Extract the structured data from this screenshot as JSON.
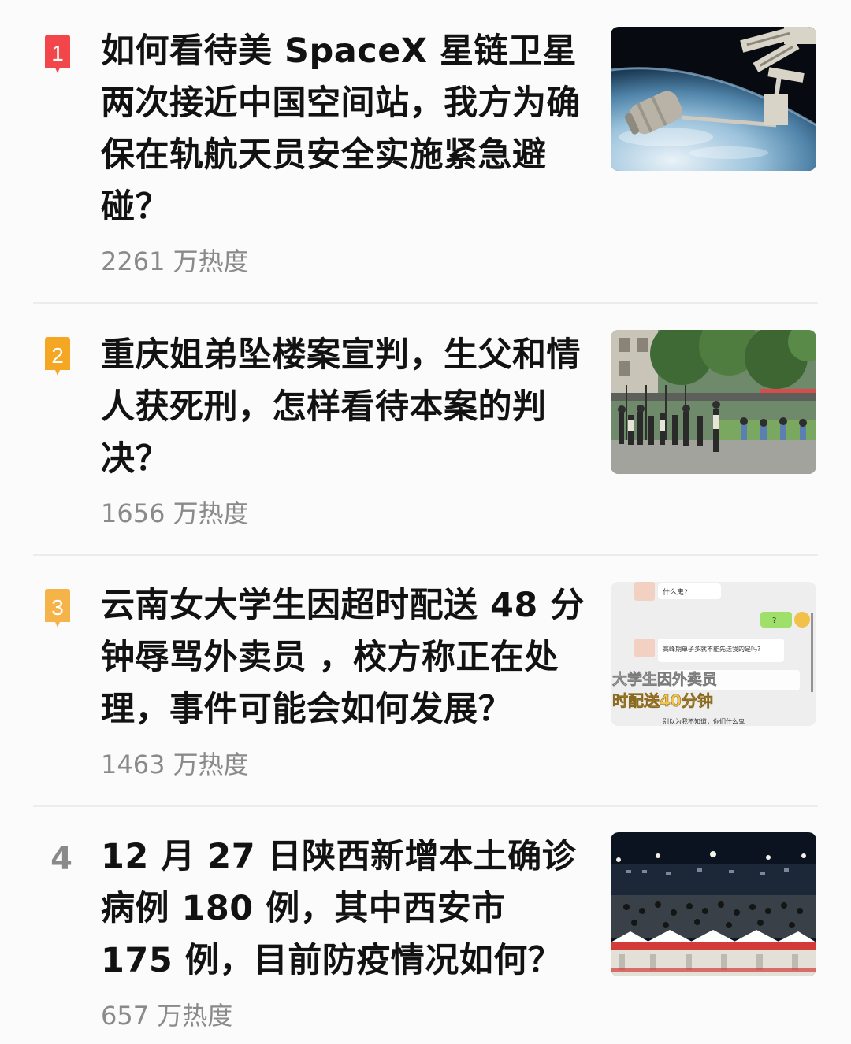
{
  "items": [
    {
      "rank": "1",
      "rank_color": "#f2464a",
      "title": "如何看待美 SpaceX 星链卫星两次接近中国空间站，我方为确保在轨航天员安全实施紧急避碰？",
      "heat": "2261 万热度",
      "thumb_icon": "space-station-image"
    },
    {
      "rank": "2",
      "rank_color": "#f5a623",
      "title": "重庆姐弟坠楼案宣判，生父和情人获死刑，怎样看待本案的判决？",
      "heat": "1656 万热度",
      "thumb_icon": "courthouse-crowd-image"
    },
    {
      "rank": "3",
      "rank_color": "#f5b44a",
      "title": "云南女大学生因超时配送 48 分钟辱骂外卖员 ，校方称正在处理，事件可能会如何发展？",
      "heat": "1463 万热度",
      "thumb_icon": "chat-screenshot-image",
      "thumb_texts": [
        "什么鬼?",
        "?",
        "高峰期单子多就不能先送我的是吗?",
        "大学生因外卖员",
        "时配送40分钟",
        "别以为我不知道，你们什么鬼"
      ]
    },
    {
      "rank": "4",
      "rank_color": "#8a8a8a",
      "title": "12 月 27 日陕西新增本土确诊病例 180 例，其中西安市 175 例，目前防疫情况如何？",
      "heat": "657 万热度",
      "thumb_icon": "night-testing-site-image"
    }
  ]
}
